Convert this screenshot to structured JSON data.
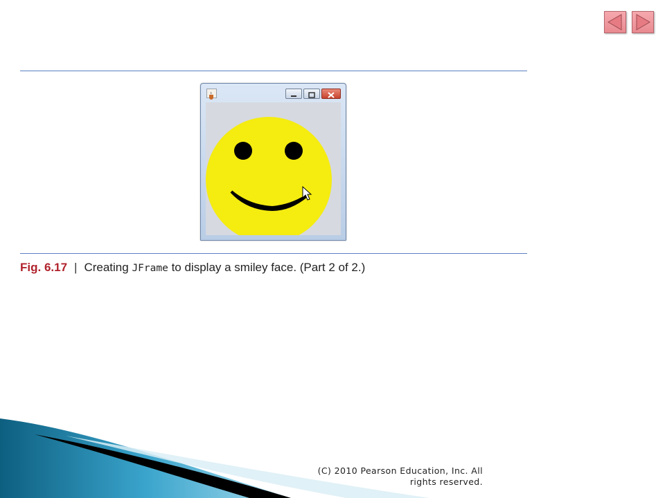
{
  "navigation": {
    "prev_icon": "triangle-left-icon",
    "next_icon": "triangle-right-icon",
    "button_color": "#f0999f"
  },
  "figure": {
    "window": {
      "icon": "java-cup-icon",
      "controls": [
        "minimize-icon",
        "maximize-icon",
        "close-icon"
      ],
      "face_color": "#f5ec10",
      "features_color": "#000000",
      "background_color": "#d6d9e0"
    },
    "caption": {
      "label": "Fig. 6.17",
      "separator": "|",
      "text_before": "Creating",
      "code": "JFrame",
      "text_after": "to display a smiley face. (Part 2 of 2.)"
    }
  },
  "footer": {
    "copyright_line1": "(C) 2010 Pearson Education, Inc. All",
    "copyright_line2": "rights reserved."
  }
}
